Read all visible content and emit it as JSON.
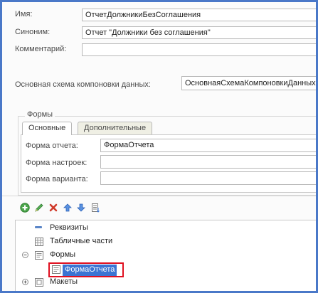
{
  "props": {
    "name_label": "Имя:",
    "name_value": "ОтчетДолжникиБезСоглашения",
    "synonym_label": "Синоним:",
    "synonym_value": "Отчет \"Должники без соглашения\"",
    "comment_label": "Комментарий:",
    "comment_value": "",
    "schema_label": "Основная схема компоновки данных:",
    "schema_value": "ОсновнаяСхемаКомпоновкиДанных"
  },
  "forms_group": {
    "title": "Формы",
    "tabs": [
      {
        "label": "Основные",
        "active": true
      },
      {
        "label": "Дополнительные",
        "active": false
      }
    ],
    "fields": [
      {
        "label": "Форма отчета:",
        "value": "ФормаОтчета"
      },
      {
        "label": "Форма настроек:",
        "value": ""
      },
      {
        "label": "Форма варианта:",
        "value": ""
      }
    ]
  },
  "toolbar": {
    "buttons": [
      "add-icon",
      "edit-icon",
      "delete-icon",
      "move-up-icon",
      "move-down-icon",
      "sort-icon"
    ],
    "colors": {
      "add": "#4ca64c",
      "edit": "#3c8e3c",
      "delete": "#d03a2a",
      "arrows": "#3b78d8"
    }
  },
  "tree": {
    "items": [
      {
        "label": "Реквизиты",
        "icon": "attribute-icon"
      },
      {
        "label": "Табличные части",
        "icon": "table-icon"
      },
      {
        "label": "Формы",
        "icon": "forms-icon",
        "expanded": true
      },
      {
        "label": "ФормаОтчета",
        "icon": "form-icon",
        "selected": true
      },
      {
        "label": "Макеты",
        "icon": "templates-icon",
        "expanded": false
      }
    ]
  },
  "colors": {
    "frame": "#4a78c8",
    "selection": "#3b74d3",
    "highlight_border": "#e01020"
  }
}
